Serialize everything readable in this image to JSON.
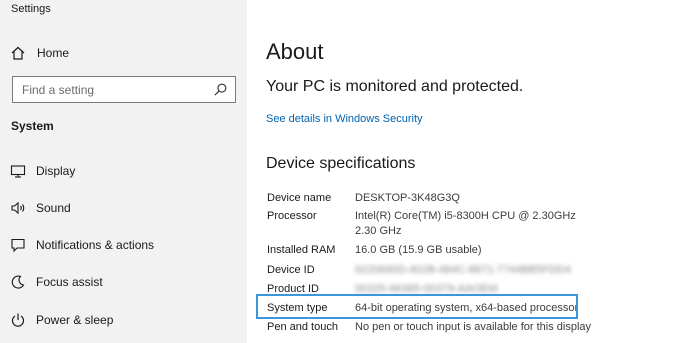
{
  "window": {
    "title": "Settings"
  },
  "sidebar": {
    "home_label": "Home",
    "search_placeholder": "Find a setting",
    "section_label": "System",
    "items": [
      {
        "label": "Display",
        "icon": "display-icon"
      },
      {
        "label": "Sound",
        "icon": "sound-icon"
      },
      {
        "label": "Notifications & actions",
        "icon": "notifications-icon"
      },
      {
        "label": "Focus assist",
        "icon": "focus-assist-icon"
      },
      {
        "label": "Power & sleep",
        "icon": "power-icon"
      }
    ]
  },
  "main": {
    "title": "About",
    "protection_status": "Your PC is monitored and protected.",
    "security_link": "See details in Windows Security",
    "specs_heading": "Device specifications",
    "specs": [
      {
        "key": "Device name",
        "value": "DESKTOP-3K48G3Q"
      },
      {
        "key": "Processor",
        "value": "Intel(R) Core(TM) i5-8300H CPU @ 2.30GHz   2.30 GHz"
      },
      {
        "key": "Installed RAM",
        "value": "16.0 GB (15.9 GB usable)"
      },
      {
        "key": "Device ID",
        "value": "6220690D-402B-484C-8871-7744BB5FDD4"
      },
      {
        "key": "Product ID",
        "value": "00325-96385-00379-AAOEM"
      },
      {
        "key": "System type",
        "value": "64-bit operating system, x64-based processor"
      },
      {
        "key": "Pen and touch",
        "value": "No pen or touch input is available for this display"
      }
    ]
  },
  "colors": {
    "sidebar_bg": "#f2f2f2",
    "link": "#0063b1",
    "highlight": "#3a96dd"
  }
}
